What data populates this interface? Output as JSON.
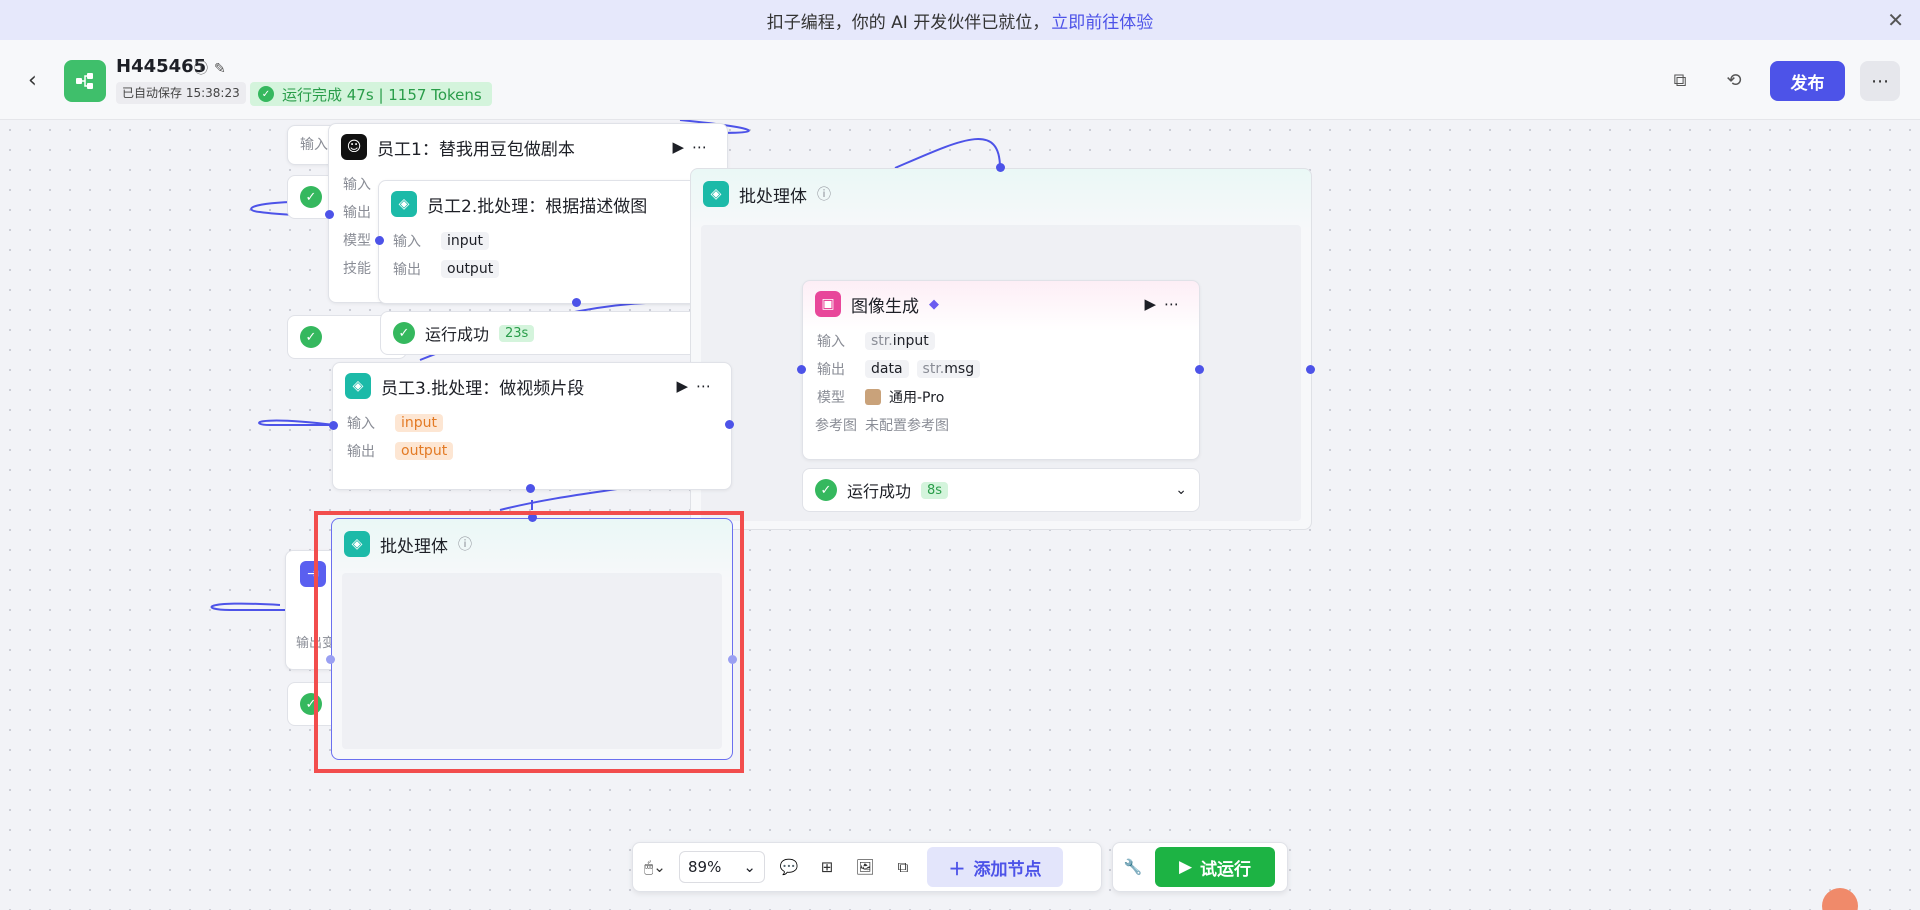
{
  "banner": {
    "text": "扣子编程，你的 AI 开发伙伴已就位，",
    "link": "立即前往体验"
  },
  "header": {
    "title": "H445465",
    "autosave": "已自动保存 15:38:23",
    "run_status": "运行完成 47s | 1157 Tokens",
    "publish": "发布"
  },
  "nodes": {
    "emp1": {
      "title": "员工1：替我用豆包做剧本",
      "rows": [
        "输入",
        "输出",
        "模型",
        "技能"
      ]
    },
    "emp2": {
      "title": "员工2.批处理：根据描述做图",
      "in_label": "输入",
      "in_val": "input",
      "out_label": "输出",
      "out_val": "output"
    },
    "emp2_status": {
      "text": "运行成功",
      "dur": "23s"
    },
    "emp3": {
      "title": "员工3.批处理：做视频片段",
      "in_label": "输入",
      "in_val": "input",
      "out_label": "输出",
      "out_val": "output"
    },
    "batch_main": {
      "title": "批处理体"
    },
    "image": {
      "title": "图像生成",
      "in_label": "输入",
      "in_type": "str.",
      "in_val": "input",
      "out_label": "输出",
      "out_val1": "data",
      "out_type2": "str.",
      "out_val2": "msg",
      "model_label": "模型",
      "model_val": "通用-Pro",
      "ref_label": "参考图",
      "ref_val": "未配置参考图"
    },
    "image_status": {
      "text": "运行成功",
      "dur": "8s"
    },
    "batch_sel": {
      "title": "批处理体"
    },
    "left_stub": {
      "label": "输入",
      "label2": "输出变"
    }
  },
  "toolbar": {
    "zoom": "89%",
    "add_node": "添加节点",
    "try_run": "试运行"
  },
  "colors": {
    "accent": "#4d53e8",
    "success": "#1db344",
    "selection": "#f24d4d"
  }
}
